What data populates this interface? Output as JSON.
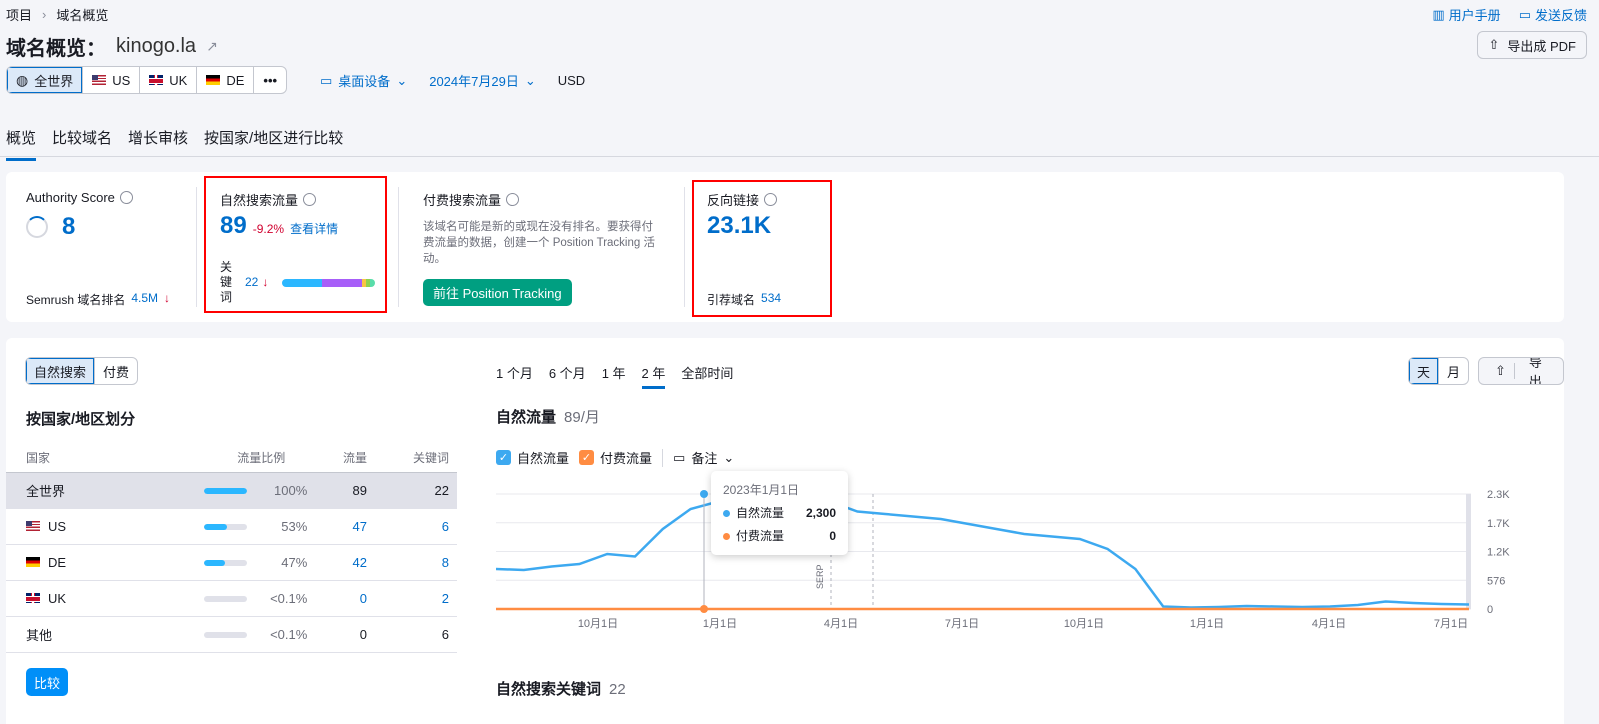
{
  "breadcrumb": {
    "root": "项目",
    "current": "域名概览"
  },
  "top_links": {
    "manual": "用户手册",
    "feedback": "发送反馈"
  },
  "page": {
    "title": "域名概览：",
    "domain": "kinogo.la",
    "export_pdf": "导出成 PDF"
  },
  "regions": [
    {
      "label": "全世界",
      "flag": "globe-icon"
    },
    {
      "label": "US",
      "flag": "us-flag-icon"
    },
    {
      "label": "UK",
      "flag": "uk-flag-icon"
    },
    {
      "label": "DE",
      "flag": "de-flag-icon"
    },
    {
      "label": "•••",
      "flag": ""
    }
  ],
  "filters": {
    "device": "桌面设备",
    "date": "2024年7月29日",
    "currency": "USD"
  },
  "tabs": [
    "概览",
    "比较域名",
    "增长审核",
    "按国家/地区进行比较"
  ],
  "summary": {
    "authority": {
      "label": "Authority Score",
      "value": "8",
      "rank_label": "Semrush 域名排名",
      "rank_value": "4.5M"
    },
    "organic": {
      "label": "自然搜索流量",
      "value": "89",
      "change": "-9.2%",
      "details": "查看详情",
      "kw_label": "关键词",
      "kw_value": "22"
    },
    "paid": {
      "label": "付费搜索流量",
      "desc": "该域名可能是新的或现在没有排名。要获得付费流量的数据，创建一个 Position Tracking 活动。",
      "button": "前往 Position Tracking"
    },
    "backlinks": {
      "label": "反向链接",
      "value": "23.1K",
      "ref_label": "引荐域名",
      "ref_value": "534"
    }
  },
  "main": {
    "toggle": [
      "自然搜索",
      "付费"
    ],
    "country_title": "按国家/地区划分",
    "table_headers": [
      "国家",
      "流量比例",
      "流量",
      "关键词"
    ],
    "rows": [
      {
        "country": "全世界",
        "flag": "",
        "share": "100%",
        "share_frac": 1.0,
        "traffic": "89",
        "keywords": "22"
      },
      {
        "country": "US",
        "flag": "us",
        "share": "53%",
        "share_frac": 0.53,
        "traffic": "47",
        "keywords": "6"
      },
      {
        "country": "DE",
        "flag": "de",
        "share": "47%",
        "share_frac": 0.47,
        "traffic": "42",
        "keywords": "8"
      },
      {
        "country": "UK",
        "flag": "uk",
        "share": "<0.1%",
        "share_frac": 0,
        "traffic": "0",
        "keywords": "2"
      },
      {
        "country": "其他",
        "flag": "",
        "share": "<0.1%",
        "share_frac": 0,
        "traffic": "0",
        "keywords": "6"
      }
    ],
    "compare": "比较",
    "periods": [
      "1 个月",
      "6 个月",
      "1 年",
      "2 年",
      "全部时间"
    ],
    "granularity": [
      "天",
      "月"
    ],
    "export": "导出",
    "traffic_title": "自然流量",
    "traffic_value": "89/月",
    "legend": {
      "organic": "自然流量",
      "paid": "付费流量",
      "notes": "备注"
    },
    "tooltip": {
      "date": "2023年1月1日",
      "organic_label": "自然流量",
      "organic_value": "2,300",
      "paid_label": "付费流量",
      "paid_value": "0"
    },
    "keywords_title": "自然搜索关键词",
    "keywords_value": "22"
  },
  "chart_data": {
    "type": "line",
    "x_ticks": [
      "10月1日",
      "1月1日",
      "4月1日",
      "7月1日",
      "10月1日",
      "1月1日",
      "4月1日",
      "7月1日"
    ],
    "y_ticks": [
      "2.3K",
      "1.7K",
      "1.2K",
      "576",
      "0"
    ],
    "ylim": [
      0,
      2300
    ],
    "annotation": "SERP",
    "series": [
      {
        "name": "自然流量",
        "color": "#3da9f0",
        "values": [
          800,
          780,
          850,
          900,
          1100,
          1050,
          1600,
          2000,
          2150,
          2300,
          2250,
          2200,
          2150,
          1950,
          1900,
          1850,
          1800,
          1700,
          1600,
          1500,
          1450,
          1400,
          1200,
          800,
          50,
          30,
          40,
          60,
          50,
          40,
          50,
          80,
          150,
          120,
          100,
          90
        ]
      },
      {
        "name": "付费流量",
        "color": "#ff8c42",
        "values": [
          0,
          0,
          0,
          0,
          0,
          0,
          0,
          0,
          0,
          0,
          0,
          0,
          0,
          0,
          0,
          0,
          0,
          0,
          0,
          0,
          0,
          0,
          0,
          0,
          0,
          0,
          0,
          0,
          0,
          0,
          0,
          0,
          0,
          0,
          0,
          0
        ]
      }
    ]
  }
}
